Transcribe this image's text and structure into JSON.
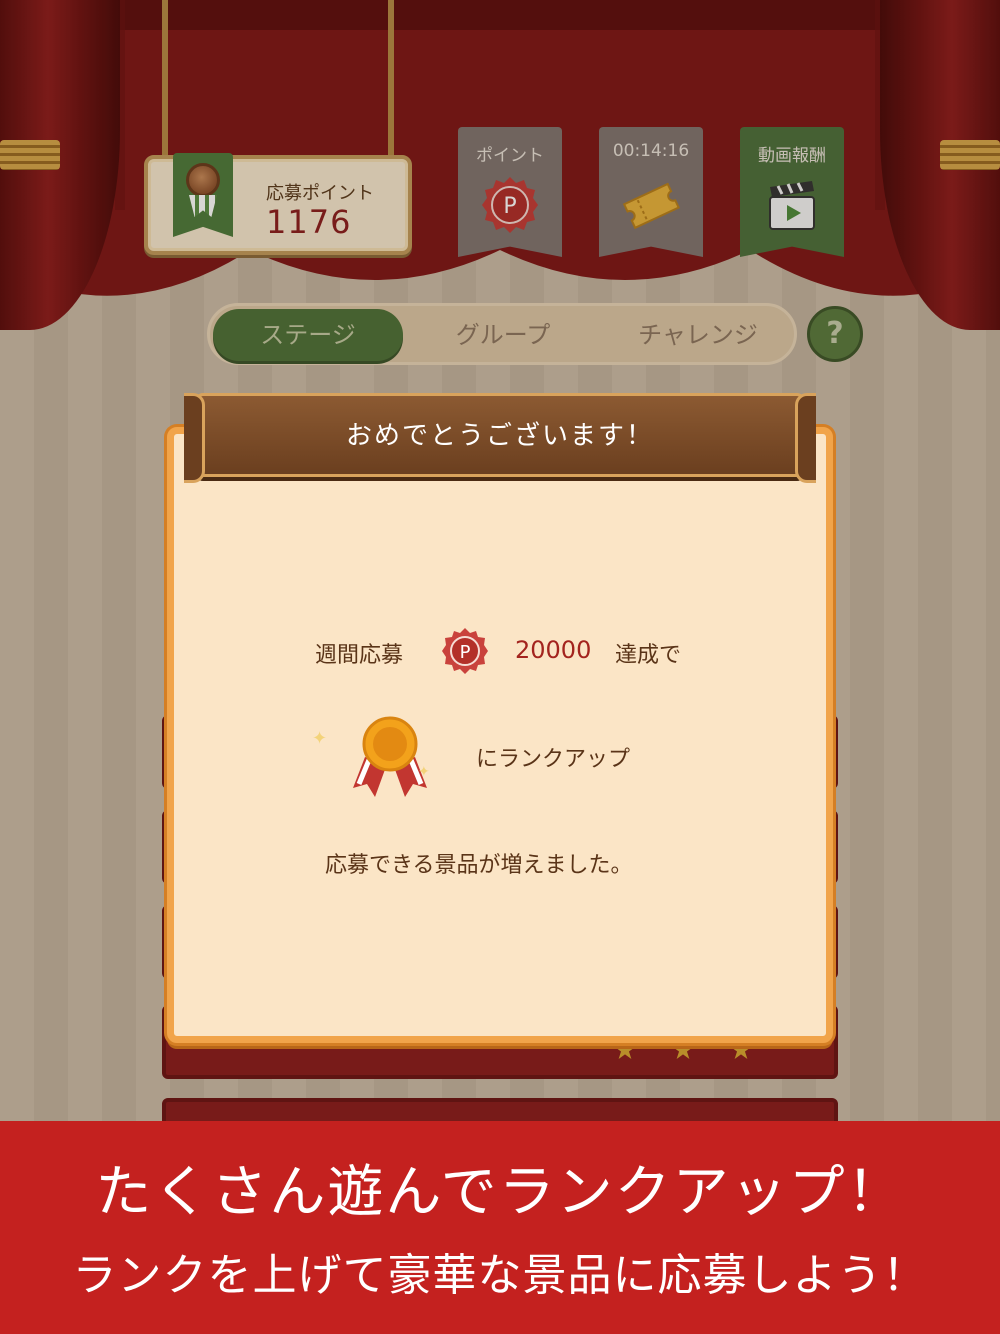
{
  "header": {
    "points_label": "応募ポイント",
    "points_value": "1176",
    "tiles": [
      {
        "label": "ポイント",
        "icon": "point-badge-icon"
      },
      {
        "label": "00:14:16",
        "icon": "ticket-icon"
      },
      {
        "label": "動画報酬",
        "icon": "video-clapper-icon"
      }
    ]
  },
  "tabs": [
    {
      "label": "ステージ",
      "active": true
    },
    {
      "label": "グループ",
      "active": false
    },
    {
      "label": "チャレンジ",
      "active": false
    }
  ],
  "help_label": "?",
  "dialog": {
    "title": "おめでとうございます！",
    "weekly_label": "週間応募",
    "p_symbol": "P",
    "goal_value": "20000",
    "achieve_label": "達成で",
    "rank_up_label": "にランクアップ",
    "message": "応募できる景品が増えました。"
  },
  "promo": {
    "line1": "たくさん遊んでランクアップ！",
    "line2": "ランクを上げて豪華な景品に応募しよう！"
  },
  "colors": {
    "curtain": "#8e1b1b",
    "green_accent": "#4e7137",
    "dialog_bg": "#fbe5c6",
    "dialog_border": "#f1a44a",
    "promo_bg": "#c4211f",
    "highlight_number": "#a3241e"
  }
}
